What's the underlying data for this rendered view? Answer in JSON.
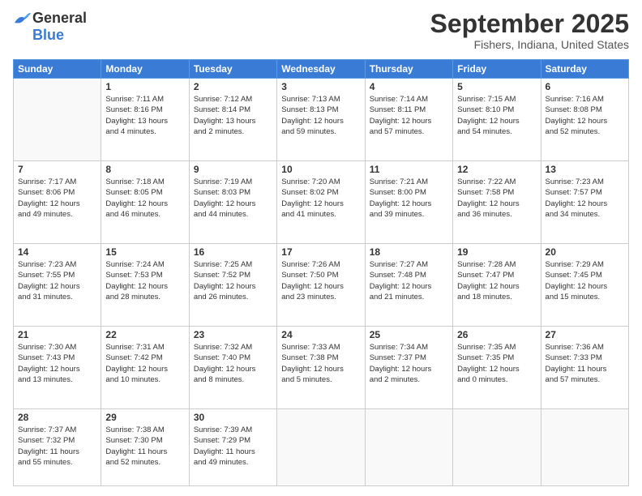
{
  "logo": {
    "line1": "General",
    "line2": "Blue"
  },
  "header": {
    "month": "September 2025",
    "location": "Fishers, Indiana, United States"
  },
  "weekdays": [
    "Sunday",
    "Monday",
    "Tuesday",
    "Wednesday",
    "Thursday",
    "Friday",
    "Saturday"
  ],
  "weeks": [
    [
      {
        "day": "",
        "info": ""
      },
      {
        "day": "1",
        "info": "Sunrise: 7:11 AM\nSunset: 8:16 PM\nDaylight: 13 hours\nand 4 minutes."
      },
      {
        "day": "2",
        "info": "Sunrise: 7:12 AM\nSunset: 8:14 PM\nDaylight: 13 hours\nand 2 minutes."
      },
      {
        "day": "3",
        "info": "Sunrise: 7:13 AM\nSunset: 8:13 PM\nDaylight: 12 hours\nand 59 minutes."
      },
      {
        "day": "4",
        "info": "Sunrise: 7:14 AM\nSunset: 8:11 PM\nDaylight: 12 hours\nand 57 minutes."
      },
      {
        "day": "5",
        "info": "Sunrise: 7:15 AM\nSunset: 8:10 PM\nDaylight: 12 hours\nand 54 minutes."
      },
      {
        "day": "6",
        "info": "Sunrise: 7:16 AM\nSunset: 8:08 PM\nDaylight: 12 hours\nand 52 minutes."
      }
    ],
    [
      {
        "day": "7",
        "info": "Sunrise: 7:17 AM\nSunset: 8:06 PM\nDaylight: 12 hours\nand 49 minutes."
      },
      {
        "day": "8",
        "info": "Sunrise: 7:18 AM\nSunset: 8:05 PM\nDaylight: 12 hours\nand 46 minutes."
      },
      {
        "day": "9",
        "info": "Sunrise: 7:19 AM\nSunset: 8:03 PM\nDaylight: 12 hours\nand 44 minutes."
      },
      {
        "day": "10",
        "info": "Sunrise: 7:20 AM\nSunset: 8:02 PM\nDaylight: 12 hours\nand 41 minutes."
      },
      {
        "day": "11",
        "info": "Sunrise: 7:21 AM\nSunset: 8:00 PM\nDaylight: 12 hours\nand 39 minutes."
      },
      {
        "day": "12",
        "info": "Sunrise: 7:22 AM\nSunset: 7:58 PM\nDaylight: 12 hours\nand 36 minutes."
      },
      {
        "day": "13",
        "info": "Sunrise: 7:23 AM\nSunset: 7:57 PM\nDaylight: 12 hours\nand 34 minutes."
      }
    ],
    [
      {
        "day": "14",
        "info": "Sunrise: 7:23 AM\nSunset: 7:55 PM\nDaylight: 12 hours\nand 31 minutes."
      },
      {
        "day": "15",
        "info": "Sunrise: 7:24 AM\nSunset: 7:53 PM\nDaylight: 12 hours\nand 28 minutes."
      },
      {
        "day": "16",
        "info": "Sunrise: 7:25 AM\nSunset: 7:52 PM\nDaylight: 12 hours\nand 26 minutes."
      },
      {
        "day": "17",
        "info": "Sunrise: 7:26 AM\nSunset: 7:50 PM\nDaylight: 12 hours\nand 23 minutes."
      },
      {
        "day": "18",
        "info": "Sunrise: 7:27 AM\nSunset: 7:48 PM\nDaylight: 12 hours\nand 21 minutes."
      },
      {
        "day": "19",
        "info": "Sunrise: 7:28 AM\nSunset: 7:47 PM\nDaylight: 12 hours\nand 18 minutes."
      },
      {
        "day": "20",
        "info": "Sunrise: 7:29 AM\nSunset: 7:45 PM\nDaylight: 12 hours\nand 15 minutes."
      }
    ],
    [
      {
        "day": "21",
        "info": "Sunrise: 7:30 AM\nSunset: 7:43 PM\nDaylight: 12 hours\nand 13 minutes."
      },
      {
        "day": "22",
        "info": "Sunrise: 7:31 AM\nSunset: 7:42 PM\nDaylight: 12 hours\nand 10 minutes."
      },
      {
        "day": "23",
        "info": "Sunrise: 7:32 AM\nSunset: 7:40 PM\nDaylight: 12 hours\nand 8 minutes."
      },
      {
        "day": "24",
        "info": "Sunrise: 7:33 AM\nSunset: 7:38 PM\nDaylight: 12 hours\nand 5 minutes."
      },
      {
        "day": "25",
        "info": "Sunrise: 7:34 AM\nSunset: 7:37 PM\nDaylight: 12 hours\nand 2 minutes."
      },
      {
        "day": "26",
        "info": "Sunrise: 7:35 AM\nSunset: 7:35 PM\nDaylight: 12 hours\nand 0 minutes."
      },
      {
        "day": "27",
        "info": "Sunrise: 7:36 AM\nSunset: 7:33 PM\nDaylight: 11 hours\nand 57 minutes."
      }
    ],
    [
      {
        "day": "28",
        "info": "Sunrise: 7:37 AM\nSunset: 7:32 PM\nDaylight: 11 hours\nand 55 minutes."
      },
      {
        "day": "29",
        "info": "Sunrise: 7:38 AM\nSunset: 7:30 PM\nDaylight: 11 hours\nand 52 minutes."
      },
      {
        "day": "30",
        "info": "Sunrise: 7:39 AM\nSunset: 7:29 PM\nDaylight: 11 hours\nand 49 minutes."
      },
      {
        "day": "",
        "info": ""
      },
      {
        "day": "",
        "info": ""
      },
      {
        "day": "",
        "info": ""
      },
      {
        "day": "",
        "info": ""
      }
    ]
  ]
}
